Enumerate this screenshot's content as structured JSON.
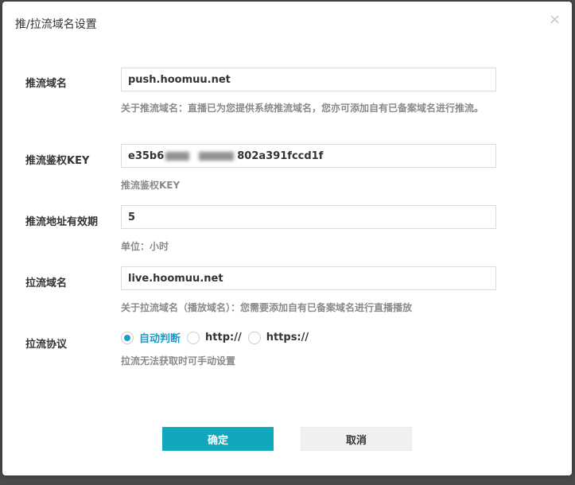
{
  "dialog": {
    "title": "推/拉流域名设置",
    "close_symbol": "×"
  },
  "fields": {
    "push_domain": {
      "label": "推流域名",
      "value": "push.hoomuu.net",
      "hint": "关于推流域名：直播已为您提供系统推流域名，您亦可添加自有已备案域名进行推流。"
    },
    "push_key": {
      "label": "推流鉴权KEY",
      "value_prefix": "e35b6",
      "value_suffix": "802a391fccd1f",
      "hint": "推流鉴权KEY"
    },
    "push_validity": {
      "label": "推流地址有效期",
      "value": "5",
      "hint": "单位：小时"
    },
    "pull_domain": {
      "label": "拉流域名",
      "value": "live.hoomuu.net",
      "hint": "关于拉流域名（播放域名）：您需要添加自有已备案域名进行直播播放"
    },
    "pull_protocol": {
      "label": "拉流协议",
      "options": [
        "自动判断",
        "http://",
        "https://"
      ],
      "selected": "自动判断",
      "hint": "拉流无法获取时可手动设置"
    }
  },
  "buttons": {
    "ok": "确定",
    "cancel": "取消"
  },
  "colors": {
    "accent": "#1a9bc9",
    "ok_button": "#11a7bd"
  }
}
